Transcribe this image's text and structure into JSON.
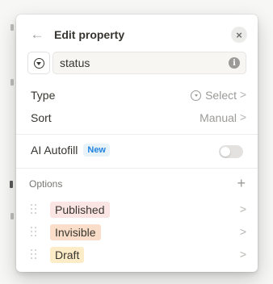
{
  "header": {
    "title": "Edit property",
    "back_icon": "arrow-left-icon",
    "close_icon": "close-icon"
  },
  "name_field": {
    "value": "status",
    "type_icon": "select-type-icon",
    "info_icon": "info-icon",
    "info_glyph": "i"
  },
  "type_row": {
    "label": "Type",
    "value": "Select",
    "value_icon": "select-type-icon",
    "chevron": ">"
  },
  "sort_row": {
    "label": "Sort",
    "value": "Manual",
    "chevron": ">"
  },
  "ai_autofill": {
    "label": "AI Autofill",
    "badge": "New",
    "enabled": false
  },
  "options": {
    "title": "Options",
    "add_glyph": "+",
    "items": [
      {
        "label": "Published",
        "bg": "#fbe4e4",
        "chevron": ">"
      },
      {
        "label": "Invisible",
        "bg": "#fadec9",
        "chevron": ">"
      },
      {
        "label": "Draft",
        "bg": "#fdecc8",
        "chevron": ">"
      }
    ]
  },
  "colors": {
    "accent": "#2383e2",
    "badge_bg": "#e7f3f8",
    "muted": "#9b9a97"
  }
}
